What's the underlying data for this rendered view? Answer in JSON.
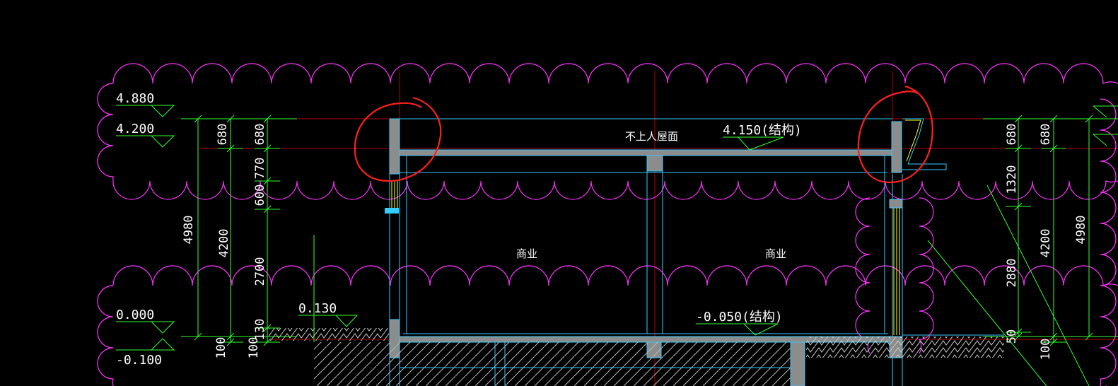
{
  "drawing": {
    "elevations_left": [
      "4.880",
      "4.200",
      "0.000",
      "-0.100"
    ],
    "elevation_mid": "0.130",
    "roof_label": "不上人屋面",
    "roof_level": "4.150(结构)",
    "floor_level": "-0.050(结构)",
    "room_labels": [
      "商业",
      "商业"
    ],
    "dims_left_outer": [
      "4980",
      "100"
    ],
    "dims_left_mid": [
      "680",
      "4200",
      "100"
    ],
    "dims_left_inner": [
      "680",
      "770",
      "600",
      "2700",
      "130"
    ],
    "dims_right_a": [
      "680",
      "1320",
      "2880",
      "50"
    ],
    "dims_right_b": [
      "680",
      "4200",
      "100"
    ],
    "dims_right_c": [
      "4980"
    ]
  },
  "colors": {
    "background": "#000000",
    "revision_cloud": "#ff33ff",
    "dimension": "#33ff33",
    "annotation_text": "#ffffff",
    "wall_fill": "#8c8c8c",
    "outline": "#33ccff",
    "axis_line": "#b40000",
    "markup_circle": "#ff2020",
    "window": "#ffff33"
  }
}
